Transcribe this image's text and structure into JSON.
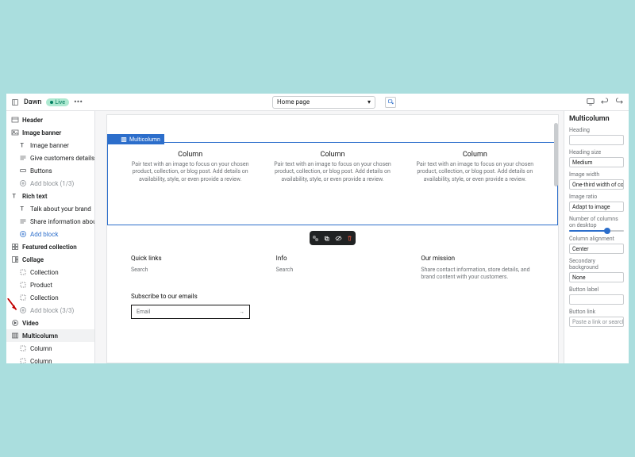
{
  "topbar": {
    "theme": "Dawn",
    "badge": "Live",
    "page_select": "Home page"
  },
  "sidebar": {
    "header": "Header",
    "image_banner": {
      "label": "Image banner",
      "items": [
        "Image banner",
        "Give customers details about ...",
        "Buttons"
      ],
      "add": "Add block (1/3)"
    },
    "rich_text": {
      "label": "Rich text",
      "items": [
        "Talk about your brand",
        "Share information about your..."
      ],
      "add": "Add block"
    },
    "featured": "Featured collection",
    "collage": {
      "label": "Collage",
      "items": [
        "Collection",
        "Product",
        "Collection"
      ],
      "add": "Add block (3/3)"
    },
    "video": "Video",
    "multicolumn": {
      "label": "Multicolumn",
      "items": [
        "Column",
        "Column",
        "Column"
      ]
    }
  },
  "preview": {
    "sel_label": "Multicolumn",
    "col_heading": "Column",
    "col_text": "Pair text with an image to focus on your chosen product, collection, or blog post. Add details on availability, style, or even provide a review.",
    "footer": {
      "quick_links": {
        "title": "Quick links",
        "link": "Search"
      },
      "info": {
        "title": "Info",
        "link": "Search"
      },
      "mission": {
        "title": "Our mission",
        "text": "Share contact information, store details, and brand content with your customers."
      }
    },
    "subscribe": {
      "title": "Subscribe to our emails",
      "placeholder": "Email"
    }
  },
  "settings": {
    "title": "Multicolumn",
    "heading_label": "Heading",
    "heading_size_label": "Heading size",
    "heading_size_value": "Medium",
    "image_width_label": "Image width",
    "image_width_value": "One-third width of column",
    "image_ratio_label": "Image ratio",
    "image_ratio_value": "Adapt to image",
    "cols_label": "Number of columns on desktop",
    "align_label": "Column alignment",
    "align_value": "Center",
    "bg_label": "Secondary background",
    "bg_value": "None",
    "btn_label_label": "Button label",
    "btn_link_label": "Button link",
    "btn_link_placeholder": "Paste a link or search"
  }
}
